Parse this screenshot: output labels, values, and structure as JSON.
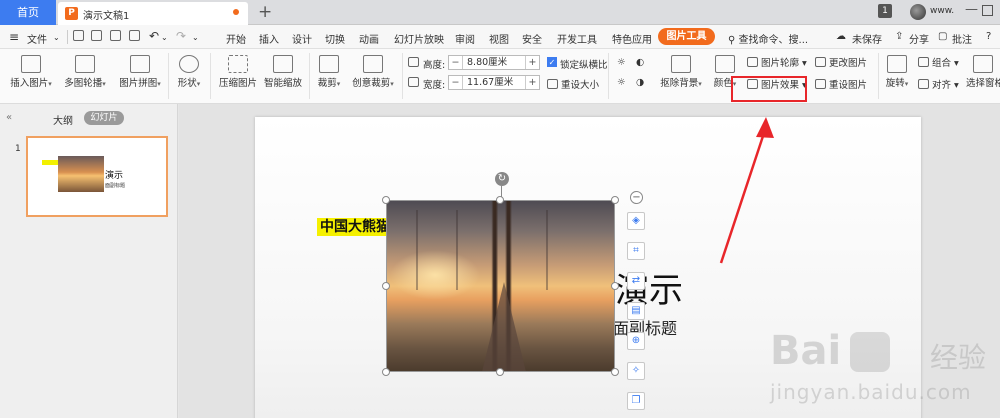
{
  "tabs": {
    "home": "首页",
    "doc": "演示文稿1",
    "add": "+"
  },
  "user": {
    "count": "1",
    "name": "www."
  },
  "menu": {
    "file": "文件",
    "items": [
      "开始",
      "插入",
      "设计",
      "切换",
      "动画",
      "幻灯片放映",
      "审阅",
      "视图",
      "安全",
      "开发工具",
      "特色应用"
    ],
    "active": "图片工具",
    "search": "查找命令、搜...",
    "unsaved": "未保存",
    "share": "分享",
    "comment": "批注",
    "help": "?"
  },
  "ribbon": {
    "insert_pic": "插入图片",
    "multi_carousel": "多图轮播",
    "pic_collage": "图片拼图",
    "shape": "形状",
    "compress": "压缩图片",
    "smart_zoom": "智能缩放",
    "crop": "裁剪",
    "creative_crop": "创意裁剪",
    "height_label": "高度:",
    "height_value": "8.80厘米",
    "width_label": "宽度:",
    "width_value": "11.67厘米",
    "lock_ratio": "锁定纵横比",
    "reset_size": "重设大小",
    "remove_bg": "抠除背景",
    "color": "颜色",
    "pic_outline": "图片轮廓",
    "pic_effect": "图片效果",
    "change_pic": "更改图片",
    "reset_pic": "重设图片",
    "rotate": "旋转",
    "group": "组合",
    "align": "对齐",
    "select_pane": "选择窗格"
  },
  "panel": {
    "outline_tab": "大纲",
    "slides_tab": "幻灯片",
    "slide_number": "1",
    "thumb_title": "演示",
    "thumb_sub": "面副标题"
  },
  "slide": {
    "title": "中国大熊猫",
    "big_text": "演示",
    "subtitle": "面副标题"
  },
  "watermark": {
    "brand": "Bai",
    "cn": "经验",
    "url": "jingyan.baidu.com"
  },
  "colors": {
    "accent": "#f26b1d",
    "home_tab": "#3d7cf0",
    "highlight_red": "#e8262a",
    "title_highlight": "#f5f000"
  }
}
